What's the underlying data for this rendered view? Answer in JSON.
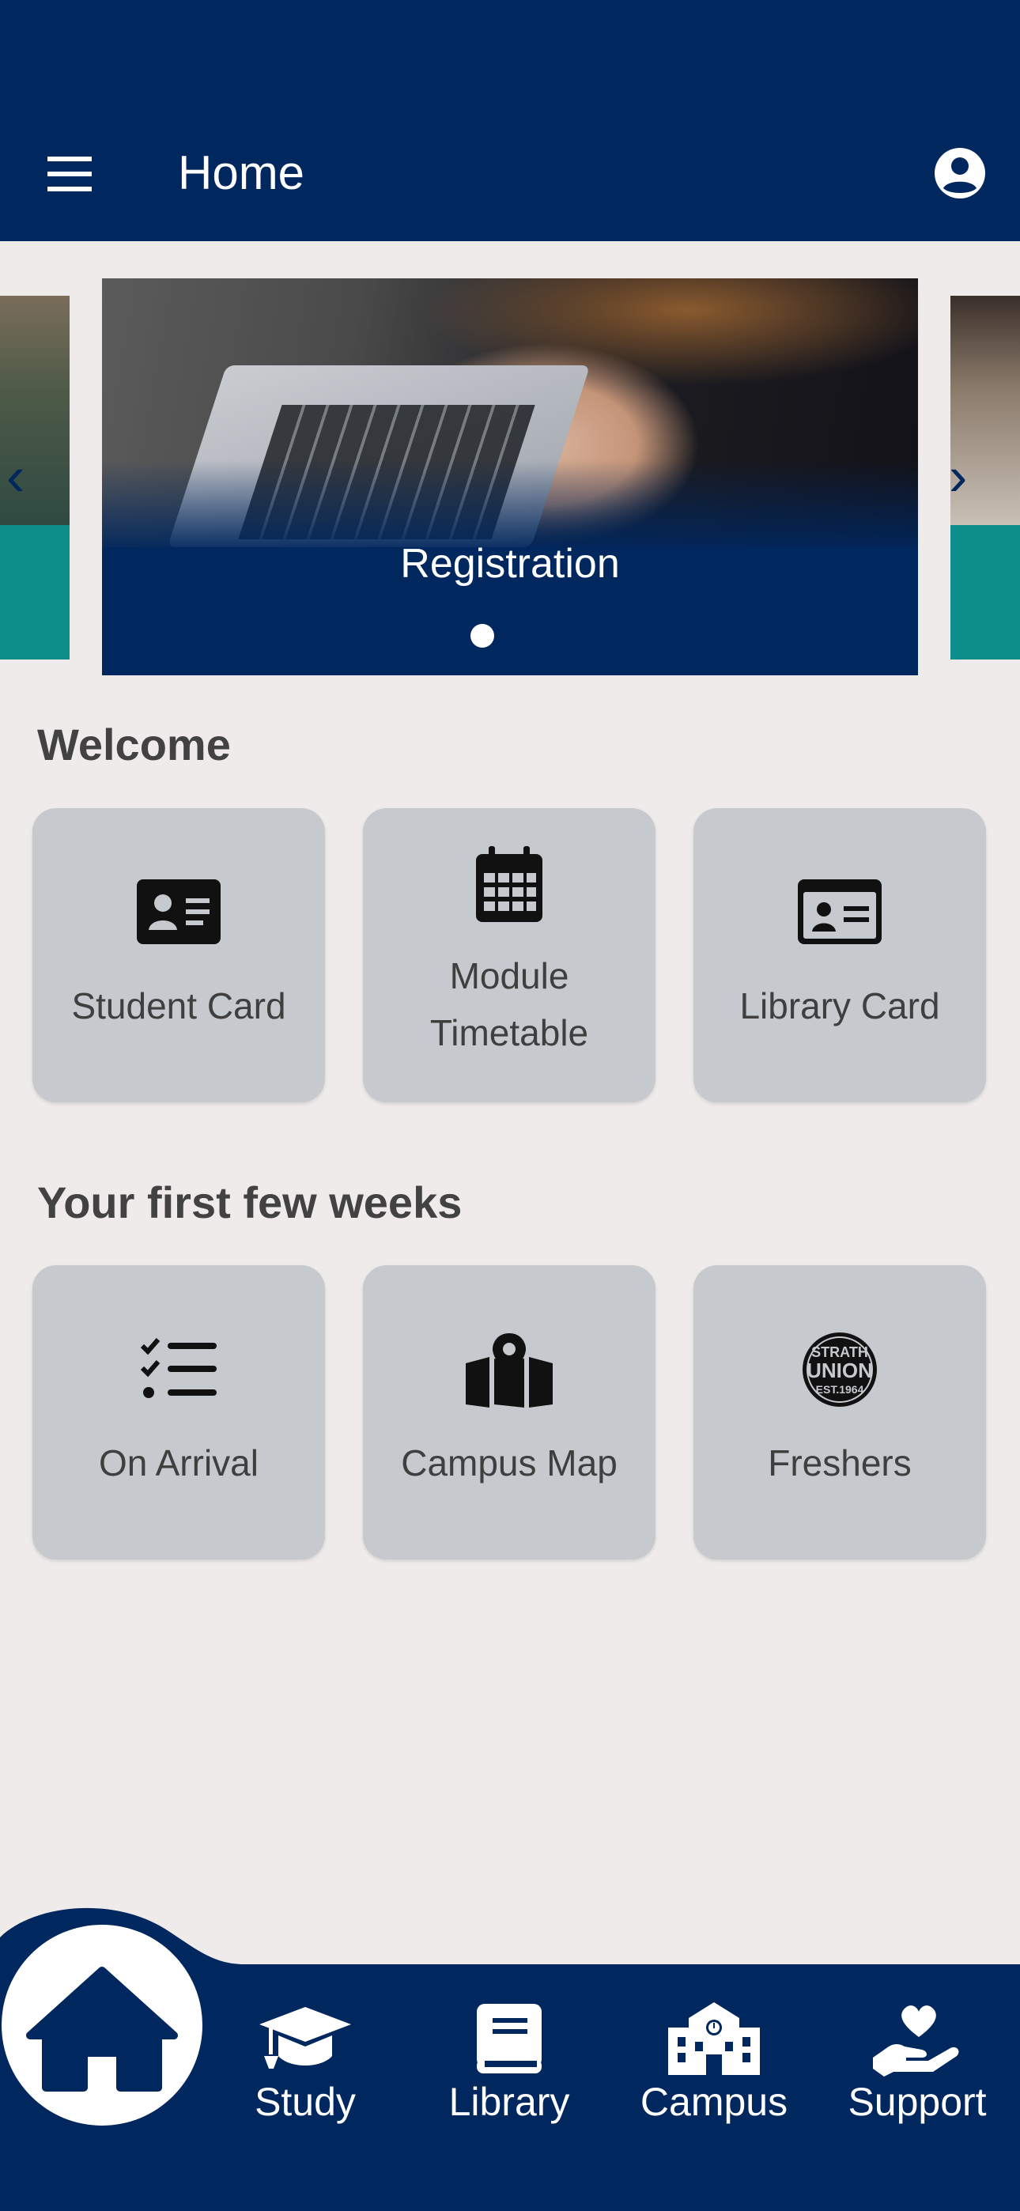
{
  "header": {
    "title": "Home",
    "menu_icon": "hamburger-menu-icon",
    "account_icon": "account-circle-icon"
  },
  "carousel": {
    "current_slide_label": "Registration",
    "prev_icon": "chevron-left-icon",
    "next_icon": "chevron-right-icon"
  },
  "welcome": {
    "title": "Welcome",
    "tiles": [
      {
        "label": "Student Card",
        "icon": "id-card-icon"
      },
      {
        "label": "Module Timetable",
        "icon": "calendar-icon"
      },
      {
        "label": "Library Card",
        "icon": "library-card-icon"
      }
    ]
  },
  "first_weeks": {
    "title": "Your first few weeks",
    "tiles": [
      {
        "label": "On Arrival",
        "icon": "checklist-icon"
      },
      {
        "label": "Campus Map",
        "icon": "map-pin-icon"
      },
      {
        "label": "Freshers",
        "icon": "strath-union-logo"
      }
    ]
  },
  "freshers_logo_text": [
    "STRATH",
    "UNION",
    "EST.1964"
  ],
  "bottom_nav": {
    "items": [
      {
        "label": "Study",
        "icon": "graduation-cap-icon"
      },
      {
        "label": "Library",
        "icon": "book-icon"
      },
      {
        "label": "Campus",
        "icon": "campus-building-icon"
      },
      {
        "label": "Support",
        "icon": "hand-heart-icon"
      }
    ],
    "home_icon": "home-icon"
  },
  "colors": {
    "primary_navy": "#00275e",
    "background": "#efebeb",
    "tile_grey": "#c6c9cd",
    "carousel_teal": "#0e8e8b"
  }
}
